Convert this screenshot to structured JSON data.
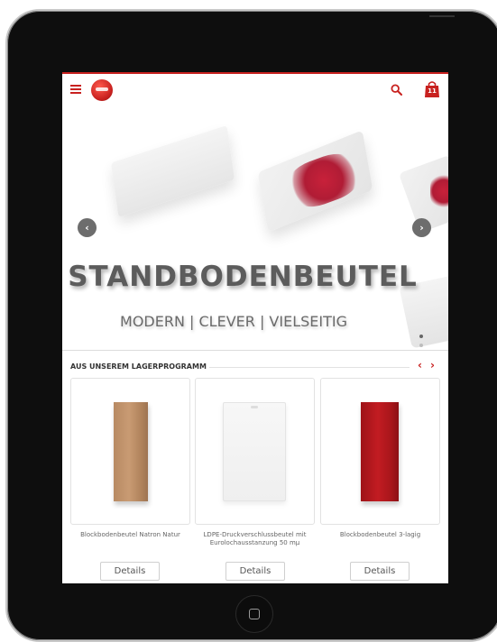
{
  "header": {
    "menu_icon": "hamburger-menu-icon",
    "logo_icon": "brand-logo",
    "search_icon": "search-icon",
    "cart_icon": "shopping-bag-icon",
    "cart_count": "11",
    "accent_color": "#c8211f"
  },
  "hero": {
    "title": "STANDBODENBEUTEL",
    "subtitle": "MODERN | CLEVER | VIELSEITIG",
    "prev_icon": "chevron-left-icon",
    "next_icon": "chevron-right-icon",
    "prev_glyph": "‹",
    "next_glyph": "›",
    "slide_count": 4,
    "active_slide": 1
  },
  "section": {
    "title": "AUS UNSEREM LAGERPROGRAMM",
    "prev_glyph": "‹",
    "next_glyph": "›"
  },
  "products": [
    {
      "name": "Blockbodenbeutel Natron Natur",
      "button": "Details"
    },
    {
      "name": "LDPE-Druckverschlussbeutel mit Eurolochausstanzung 50 mμ",
      "button": "Details"
    },
    {
      "name": "Blockbodenbeutel 3-lagig",
      "button": "Details"
    }
  ]
}
